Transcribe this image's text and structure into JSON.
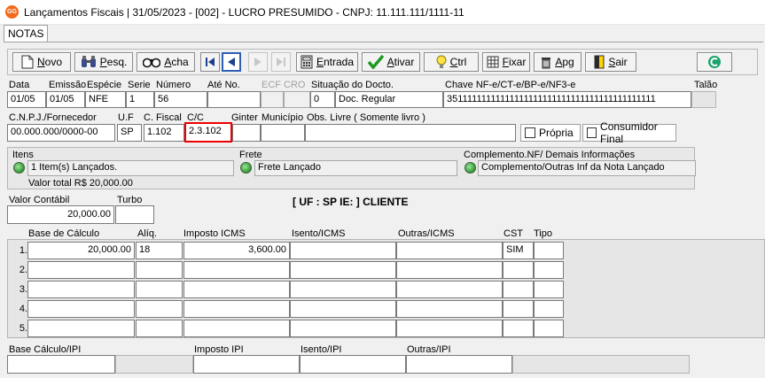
{
  "window": {
    "app_icon": "GG",
    "title": "Lançamentos Fiscais |  31/05/2023 - [002] - LUCRO PRESUMIDO - CNPJ: 11.111.111/1111-11"
  },
  "tabs": [
    {
      "label": "NOTAS"
    }
  ],
  "toolbar": {
    "novo_pre": "N",
    "novo_post": "ovo",
    "pesq_pre": "P",
    "pesq_post": "esq.",
    "acha_pre": "A",
    "acha_post": "cha",
    "entrada_pre": "E",
    "entrada_post": "ntrada",
    "ativar_pre": "A",
    "ativar_post": "tivar",
    "ctrl_pre": "C",
    "ctrl_post": "trl",
    "fixar_pre": "F",
    "fixar_post": "ixar",
    "apg_pre": "A",
    "apg_post": "pg",
    "sair_pre": "S",
    "sair_post": "air"
  },
  "header_labels": {
    "data": "Data",
    "emissao": "Emissão",
    "especie": "Espécie",
    "serie": "Serie",
    "numero": "Número",
    "ate_no": "Até No.",
    "ecf": "ECF",
    "cro": "CRO",
    "situacao": "Situação do Docto.",
    "chave": "Chave NF-e/CT-e/BP-e/NF3-e",
    "talao": "Talão"
  },
  "header_values": {
    "data": "01/05",
    "emissao": "01/05",
    "especie": "NFE",
    "serie": "1",
    "numero": "56",
    "ate_no": "",
    "situacao_cod": "0",
    "situacao_desc": "Doc. Regular",
    "chave": "35111111111111111111111111111111111111111111",
    "talao": ""
  },
  "row2_labels": {
    "cnpj": "C.N.P.J./Fornecedor",
    "uf": "U.F",
    "cfiscal": "C. Fiscal",
    "cc": "C/C",
    "ginter": "Ginter",
    "municipio": "Município",
    "obs": "Obs. Livre ( Somente livro )"
  },
  "row2_values": {
    "cnpj": "00.000.000/0000-00",
    "uf": "SP",
    "cfiscal": "1.102",
    "cc": "2.3.102",
    "ginter": "",
    "municipio": "",
    "obs": ""
  },
  "checkboxes": {
    "propria": "Própria",
    "consumidor_final": "Consumidor Final"
  },
  "info": {
    "itens_label": "Itens",
    "itens_value": "1 Item(s) Lançados.",
    "valor_total": "Valor total R$ 20,000.00",
    "frete_label": "Frete",
    "frete_value": "Frete Lançado",
    "complemento_label": "Complemento.NF/ Demais Informações",
    "complemento_value": "Complemento/Outras Inf da Nota Lançado"
  },
  "valores": {
    "valor_contabil_label": "Valor Contábil",
    "valor_contabil": "20,000.00",
    "turbo_label": "Turbo",
    "turbo": "",
    "uf_ie": "[ UF : SP IE:  ] CLIENTE"
  },
  "grid": {
    "headers": [
      "Base de Cálculo",
      "Alíq.",
      "Imposto ICMS",
      "Isento/ICMS",
      "Outras/ICMS",
      "CST",
      "Tipo"
    ],
    "rows": [
      {
        "n": "1.",
        "base": "20,000.00",
        "aliq": "18",
        "imposto": "3,600.00",
        "isento": "",
        "outras": "",
        "cst": "SIM",
        "tipo": ""
      },
      {
        "n": "2.",
        "base": "",
        "aliq": "",
        "imposto": "",
        "isento": "",
        "outras": "",
        "cst": "",
        "tipo": ""
      },
      {
        "n": "3.",
        "base": "",
        "aliq": "",
        "imposto": "",
        "isento": "",
        "outras": "",
        "cst": "",
        "tipo": ""
      },
      {
        "n": "4.",
        "base": "",
        "aliq": "",
        "imposto": "",
        "isento": "",
        "outras": "",
        "cst": "",
        "tipo": ""
      },
      {
        "n": "5.",
        "base": "",
        "aliq": "",
        "imposto": "",
        "isento": "",
        "outras": "",
        "cst": "",
        "tipo": ""
      }
    ]
  },
  "ipi": {
    "base_label": "Base Cálculo/IPI",
    "imposto_label": "Imposto IPI",
    "isento_label": "Isento/IPI",
    "outras_label": "Outras/IPI",
    "base": "",
    "imposto": "",
    "isento": "",
    "outras": ""
  },
  "colors": {
    "highlight": "#e00000",
    "nav_active": "#2f5fb3",
    "green_dot": "#2f9a2f"
  }
}
